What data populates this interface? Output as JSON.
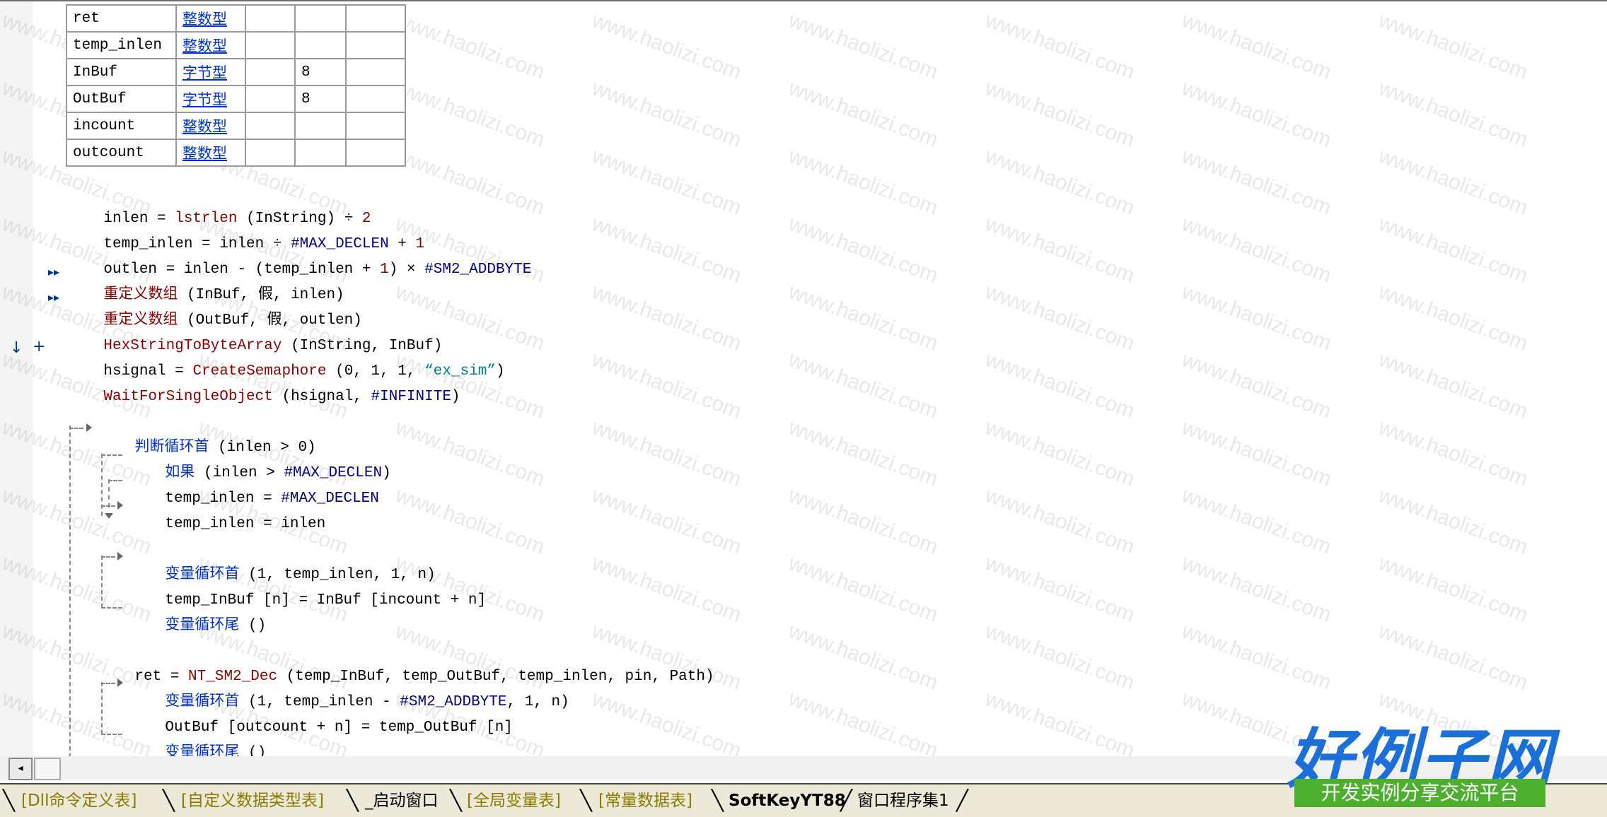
{
  "variables": [
    {
      "name": "ret",
      "type": "整数型",
      "size": ""
    },
    {
      "name": "temp_inlen",
      "type": "整数型",
      "size": ""
    },
    {
      "name": "InBuf",
      "type": "字节型",
      "size": "8"
    },
    {
      "name": "OutBuf",
      "type": "字节型",
      "size": "8"
    },
    {
      "name": "incount",
      "type": "整数型",
      "size": ""
    },
    {
      "name": "outcount",
      "type": "整数型",
      "size": ""
    }
  ],
  "code": {
    "l1_var": "inlen = ",
    "l1_fn": "lstrlen",
    "l1_args": " (InString) ÷ ",
    "l1_num": "2",
    "l2_a": "temp_inlen = inlen ÷ ",
    "l2_const": "#MAX_DECLEN",
    "l2_b": " + ",
    "l2_num": "1",
    "l3_a": "outlen = inlen - (temp_inlen + ",
    "l3_num": "1",
    "l3_b": ") × ",
    "l3_const": "#SM2_ADDBYTE",
    "l4_fn": "重定义数组",
    "l4_args": " (InBuf, 假, inlen)",
    "l5_fn": "重定义数组",
    "l5_args": " (OutBuf, 假, outlen)",
    "l6_fn": "HexStringToByteArray",
    "l6_args": " (InString, InBuf)",
    "l7_a": "hsignal = ",
    "l7_fn": "CreateSemaphore",
    "l7_b": " (0, 1, 1, ",
    "l7_str": "“ex_sim”",
    "l7_c": ")",
    "l8_fn": "WaitForSingleObject",
    "l8_a": " (hsignal, ",
    "l8_const": "#INFINITE",
    "l8_b": ")",
    "l9_kw": "判断循环首",
    "l9_args": " (inlen > 0)",
    "l10_kw": "如果",
    "l10_a": " (inlen > ",
    "l10_const": "#MAX_DECLEN",
    "l10_b": ")",
    "l11_a": "temp_inlen = ",
    "l11_const": "#MAX_DECLEN",
    "l12": "temp_inlen = inlen",
    "l13_kw": "变量循环首",
    "l13_args": " (1, temp_inlen, 1, n)",
    "l14": "temp_InBuf [n] = InBuf [incount + n]",
    "l15_kw": "变量循环尾",
    "l15_args": " ()",
    "l16_a": "ret = ",
    "l16_fn": "NT_SM2_Dec",
    "l16_args": " (temp_InBuf, temp_OutBuf, temp_inlen, pin, Path)",
    "l17_kw": "变量循环首",
    "l17_a": " (1, temp_inlen - ",
    "l17_const": "#SM2_ADDBYTE",
    "l17_b": ", 1, n)",
    "l18": "OutBuf [outcount + n] = temp_OutBuf [n]",
    "l19_kw": "变量循环尾",
    "l19_args": " ()"
  },
  "markers": {
    "arrow1": "▸▸",
    "arrow2": "▸▸",
    "down": "↓",
    "plus": "+"
  },
  "tabs": [
    "[Dll命令定义表]",
    "[自定义数据类型表]",
    "_启动窗口",
    "[全局变量表]",
    "[常量数据表]",
    "SoftKeyYT88",
    "窗口程序集1"
  ],
  "watermark": "www.haolizi.com",
  "logo": {
    "title": "好例子网",
    "subtitle": "开发实例分享交流平台"
  },
  "colors": {
    "function": "#8b0000",
    "keyword": "#0033cc",
    "string": "#008080",
    "constant": "#000080",
    "logo_blue": "#1b6fd8",
    "logo_green": "#4caf2e"
  }
}
